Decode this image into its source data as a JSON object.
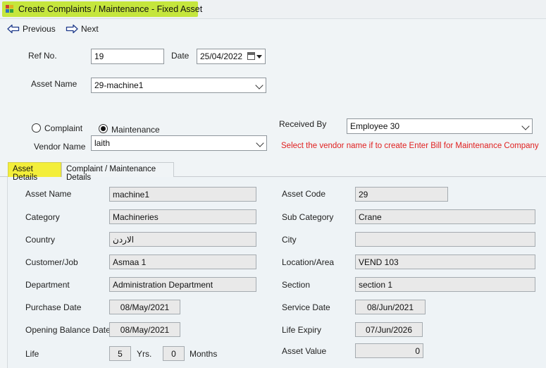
{
  "window": {
    "title": "Create Complaints / Maintenance - Fixed Asset"
  },
  "toolbar": {
    "previous_label": "Previous",
    "next_label": "Next"
  },
  "form": {
    "ref_no_label": "Ref No.",
    "ref_no_value": "19",
    "date_label": "Date",
    "date_value": "25/04/2022",
    "asset_name_label": "Asset Name",
    "asset_name_value": "29-machine1",
    "type_options": {
      "complaint": "Complaint",
      "maintenance": "Maintenance",
      "selected": "maintenance"
    },
    "received_by_label": "Received By",
    "received_by_value": "Employee 30",
    "vendor_name_label": "Vendor Name",
    "vendor_name_value": "laith",
    "vendor_hint": "Select the vendor name if to  create Enter Bill for Maintenance Company"
  },
  "tabs": [
    {
      "label": "Asset Details",
      "active": true
    },
    {
      "label": "Complaint / Maintenance Details",
      "active": false
    }
  ],
  "asset_details": {
    "asset_name": {
      "label": "Asset Name",
      "value": "machine1"
    },
    "asset_code": {
      "label": "Asset Code",
      "value": "29"
    },
    "category": {
      "label": "Category",
      "value": "Machineries"
    },
    "sub_category": {
      "label": "Sub Category",
      "value": "Crane"
    },
    "country": {
      "label": "Country",
      "value": "الاردن"
    },
    "city": {
      "label": "City",
      "value": ""
    },
    "customer_job": {
      "label": "Customer/Job",
      "value": "Asmaa 1"
    },
    "location_area": {
      "label": "Location/Area",
      "value": "VEND 103"
    },
    "department": {
      "label": "Department",
      "value": "Administration Department"
    },
    "section": {
      "label": "Section",
      "value": "section 1"
    },
    "purchase_date": {
      "label": "Purchase Date",
      "value": "08/May/2021"
    },
    "service_date": {
      "label": "Service Date",
      "value": "08/Jun/2021"
    },
    "opening_balance_date": {
      "label": "Opening Balance Date",
      "value": "08/May/2021"
    },
    "life_expiry": {
      "label": "Life Expiry",
      "value": "07/Jun/2026"
    },
    "life": {
      "label": "Life",
      "years": "5",
      "years_unit": "Yrs.",
      "months": "0",
      "months_unit": "Months"
    },
    "asset_value": {
      "label": "Asset Value",
      "value": "0"
    }
  },
  "colors": {
    "title_highlight": "#c5e63d",
    "active_tab": "#f3ee3a",
    "hint_text": "#e02020"
  }
}
